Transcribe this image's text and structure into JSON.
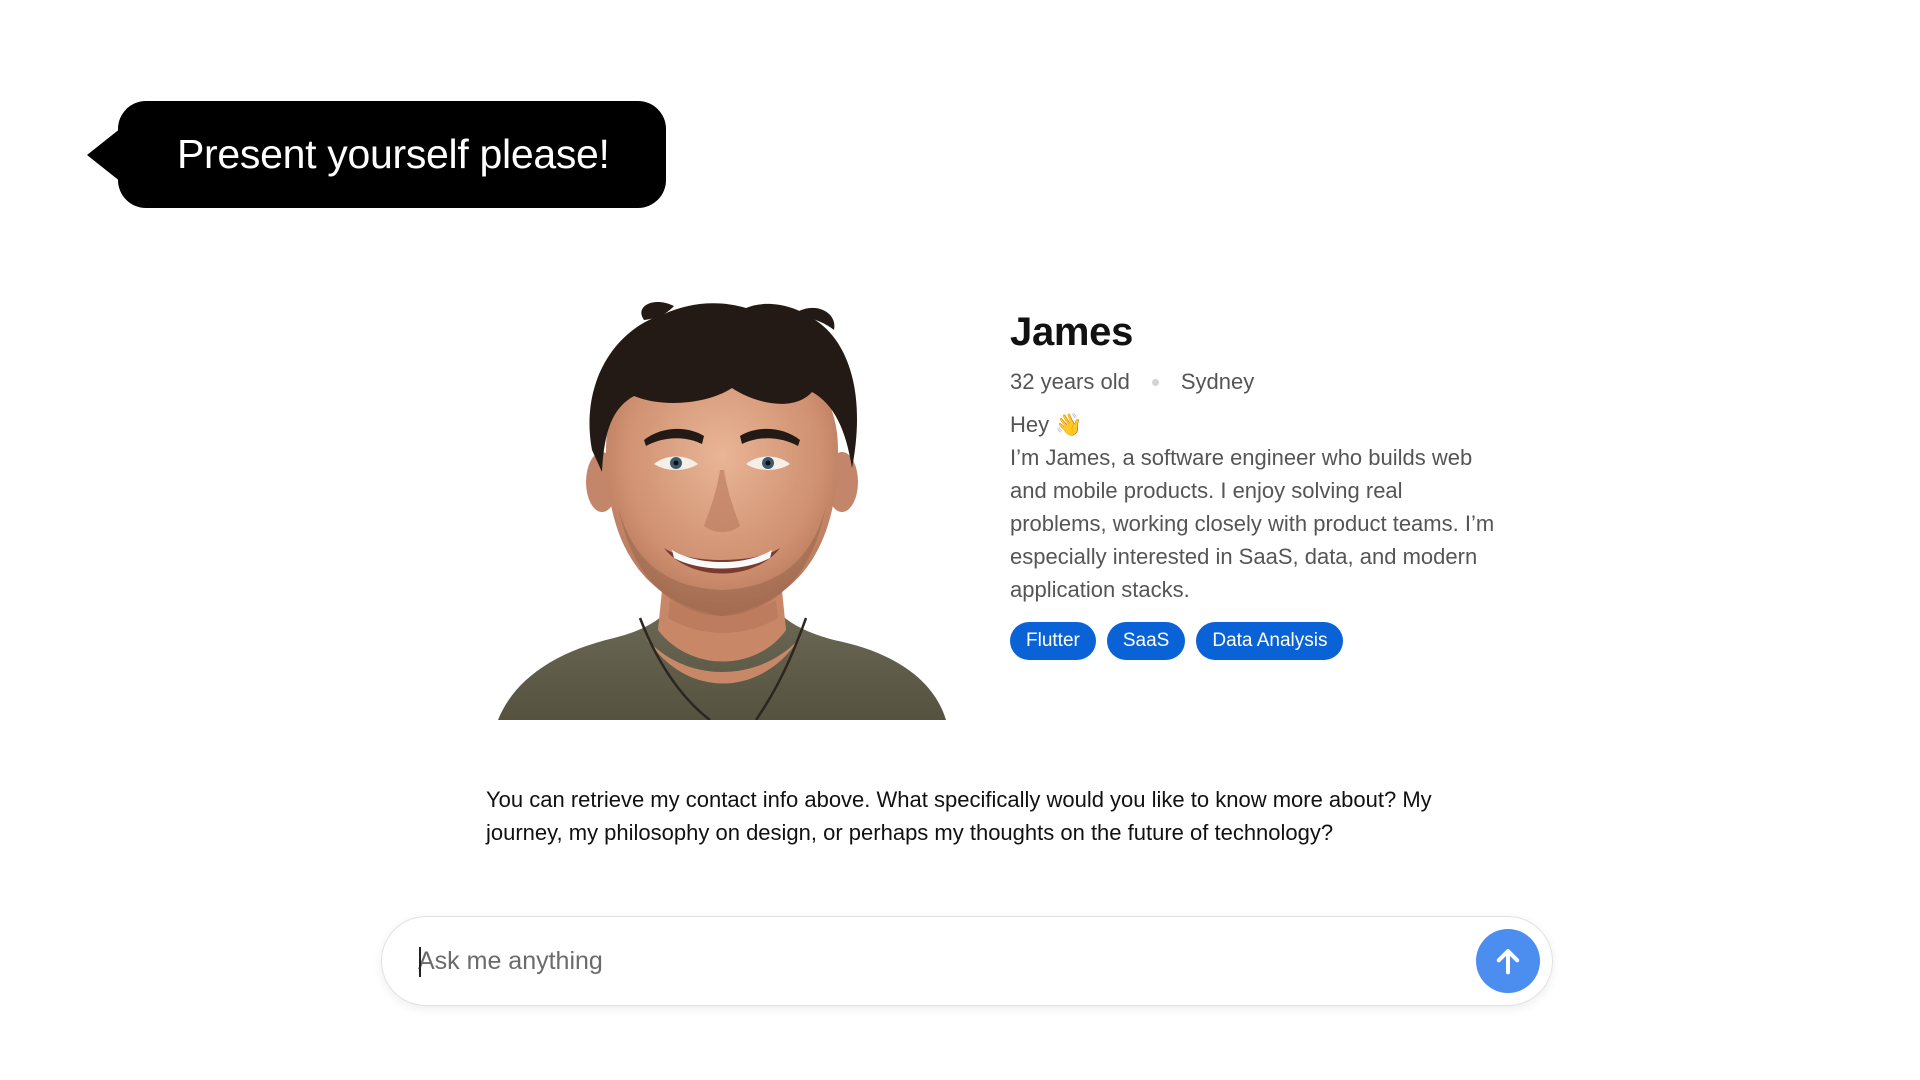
{
  "prompt_bubble": {
    "text": "Present yourself please!"
  },
  "profile": {
    "name": "James",
    "age": "32 years old",
    "location": "Sydney",
    "greeting": "Hey 👋",
    "bio": "I’m James, a software engineer who builds web and mobile products. I enjoy solving real problems, working closely with product teams. I’m especially interested in SaaS, data, and modern application stacks.",
    "tags": [
      "Flutter",
      "SaaS",
      "Data Analysis"
    ],
    "photo_icon": "portrait-photo"
  },
  "assistant_message": {
    "text": "You can retrieve my contact info above. What specifically would you like to know more about? My journey, my philosophy on design, or perhaps my thoughts on the future of technology?"
  },
  "chat_input": {
    "value": "",
    "placeholder": "Ask me anything",
    "send_icon": "arrow-up-icon"
  },
  "colors": {
    "bubble": "#000000",
    "tag": "#0a63d6",
    "send_button": "#4b8ef0"
  }
}
